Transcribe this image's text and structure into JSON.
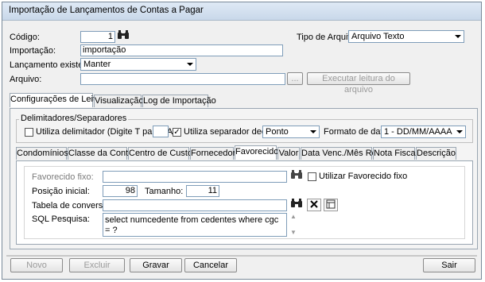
{
  "window": {
    "title": "Importação de Lançamentos de Contas a Pagar"
  },
  "header": {
    "codigo_label": "Código:",
    "codigo_value": "1",
    "importacao_label": "Importação:",
    "importacao_value": "importação",
    "lancamento_label": "Lançamento existente:",
    "lancamento_value": "Manter",
    "arquivo_label": "Arquivo:",
    "arquivo_value": "",
    "browse_label": "...",
    "executar_label": "Executar leitura do arquivo",
    "tipo_arquivo_label": "Tipo de Arquivo:",
    "tipo_arquivo_value": "Arquivo Texto"
  },
  "main_tabs": [
    {
      "label": "Configurações de Leitura",
      "active": true
    },
    {
      "label": "Visualização",
      "active": false
    },
    {
      "label": "Log de Importação",
      "active": false
    }
  ],
  "delimiters": {
    "group_label": "Delimitadores/Separadores",
    "utiliza_delimitador_label": "Utiliza delimitador (Digite T para TAB)",
    "utiliza_delimitador_checked": false,
    "delimitador_value": "",
    "utiliza_separador_label": "Utiliza separador decimal",
    "utiliza_separador_checked": true,
    "separador_value": "Ponto",
    "formato_data_label": "Formato de data:",
    "formato_data_value": "1 - DD/MM/AAAA"
  },
  "sub_tabs": [
    {
      "label": "Condomínios",
      "active": false
    },
    {
      "label": "Classe da Conta",
      "active": false
    },
    {
      "label": "Centro de Custos",
      "active": false
    },
    {
      "label": "Fornecedor",
      "active": false
    },
    {
      "label": "Favorecido",
      "active": true
    },
    {
      "label": "Valor",
      "active": false
    },
    {
      "label": "Data Venc./Mês Ref.",
      "active": false
    },
    {
      "label": "Nota Fiscal",
      "active": false
    },
    {
      "label": "Descrição",
      "active": false
    }
  ],
  "favorecido": {
    "fixo_label": "Favorecido fixo:",
    "fixo_value": "",
    "utilizar_fixo_label": "Utilizar Favorecido fixo",
    "utilizar_fixo_checked": false,
    "posicao_label": "Posição inicial:",
    "posicao_value": "98",
    "tamanho_label": "Tamanho:",
    "tamanho_value": "11",
    "tabela_label": "Tabela de conversão:",
    "tabela_value": "",
    "sql_label": "SQL Pesquisa:",
    "sql_value": "select numcedente from cedentes where cgc = ?"
  },
  "footer": {
    "novo": "Novo",
    "excluir": "Excluir",
    "gravar": "Gravar",
    "cancelar": "Cancelar",
    "sair": "Sair"
  }
}
